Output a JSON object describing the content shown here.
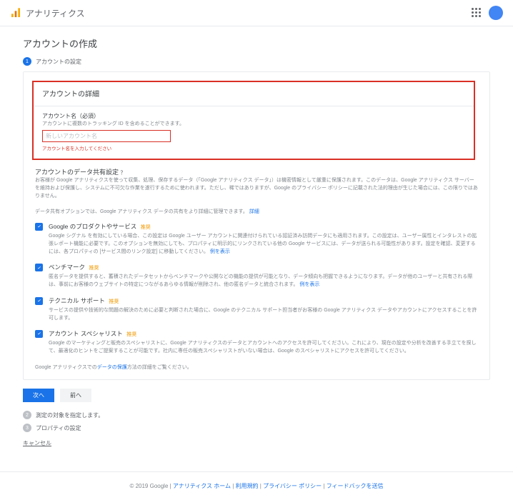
{
  "header": {
    "product_name": "アナリティクス"
  },
  "page": {
    "title": "アカウントの作成",
    "step1_label": "アカウントの設定",
    "step2_label": "測定の対象を指定します。",
    "step3_label": "プロパティの設定"
  },
  "details": {
    "section_title": "アカウントの詳細",
    "field_label": "アカウント名（必須）",
    "field_sub": "アカウントに複数のトラッキング ID を含めることができます。",
    "placeholder": "新しいアカウント名",
    "error": "アカウント名を入力してください"
  },
  "sharing": {
    "heading": "アカウントのデータ共有設定",
    "required_badge": "？",
    "heading_desc": "お客様が Google アナリティクスを使って収集、処理、保存するデータ（「Google アナリティクス データ」）は機密情報として厳重に保護されます。このデータは、Google アナリティクス サーバーを維持および保護し、システムに不可欠な作業を遂行するために使われます。ただし、稀ではありますが、Google のプライバシー ポリシーに記載された法的理由が生じた場合には、この限りではありません。",
    "intro": "データ共有オプションでは、Google アナリティクス データの共有をより詳細に管理できます。",
    "intro_link": "詳細",
    "options": [
      {
        "title": "Google のプロダクトやサービス",
        "reco": "推奨",
        "desc": "Google シグナル を有効にしている場合、この設定は Google ユーザー アカウントに関連付けられている認証済み訪問データにも適用されます。この設定は、ユーザー属性とインタレストの拡張レポート機能に必要です。このオプションを無効にしても、プロパティに明示的にリンクされている他の Google サービスには、データが送られる可能性があります。設定を確認、変更するには、各プロパティの [サービス間のリンク設定] に移動してください。",
        "desc_link": "例を表示"
      },
      {
        "title": "ベンチマーク",
        "reco": "推奨",
        "desc": "匿名データを提供すると、蓄積されたデータセットからベンチマークや公開などの機能の提供が可能となり、データ傾向も把握できるようになります。データが他のユーザーと共有される際は、事前にお客様のウェブサイトの特定につながるあらゆる情報が削除され、他の匿名データと統合されます。",
        "desc_link": "例を表示"
      },
      {
        "title": "テクニカル サポート",
        "reco": "推奨",
        "desc": "サービスの提供や技術的な問題の解決のために必要と判断された場合に、Google のテクニカル サポート担当者がお客様の Google アナリティクス データやアカウントにアクセスすることを許可します。"
      },
      {
        "title": "アカウント スペシャリスト",
        "reco": "推奨",
        "desc": "Google のマーケティングと販売のスペシャリストに、Google アナリティクスのデータとアカウントへのアクセスを許可してください。これにより、現在の設定や分析を改善する手立てを探して、最適化のヒントをご提案することが可能です。社内に専任の販売スペシャリストがいない場合は、Google のスペシャリストにアクセスを許可してください。"
      }
    ],
    "protect_note_prefix": "Google アナリティクスでの",
    "protect_note_link": "データの保護",
    "protect_note_suffix": "方法の詳細をご覧ください。"
  },
  "buttons": {
    "next": "次へ",
    "prev": "前へ",
    "cancel": "キャンセル"
  },
  "footer": {
    "copyright": "© 2019 Google",
    "links": [
      "アナリティクス ホーム",
      "利用規約",
      "プライバシー ポリシー",
      "フィードバックを送信"
    ]
  }
}
